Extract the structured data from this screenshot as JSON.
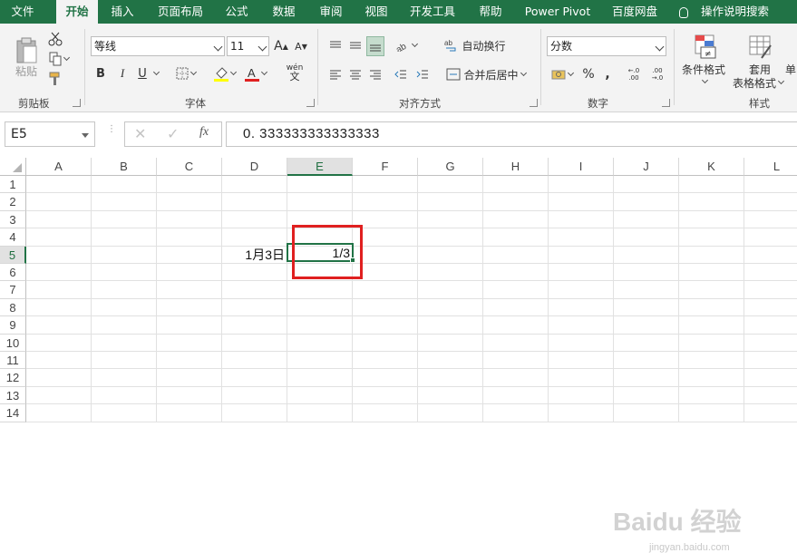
{
  "tabs": [
    "文件",
    "开始",
    "插入",
    "页面布局",
    "公式",
    "数据",
    "审阅",
    "视图",
    "开发工具",
    "帮助",
    "Power Pivot",
    "百度网盘"
  ],
  "active_tab": "开始",
  "tell_me": "操作说明搜索",
  "ribbon": {
    "clipboard": {
      "paste": "粘贴",
      "label": "剪贴板"
    },
    "font": {
      "name": "等线",
      "size": "11",
      "bold": "B",
      "italic": "I",
      "underline": "U",
      "phonetic": "wén",
      "label": "字体"
    },
    "alignment": {
      "wrap": "自动换行",
      "merge": "合并后居中",
      "label": "对齐方式"
    },
    "number": {
      "format": "分数",
      "percent": "%",
      "comma": ",",
      "inc_decimal": "←.0 .00",
      "dec_decimal": ".00 →.0",
      "label": "数字"
    },
    "styles": {
      "cond_format": "条件格式",
      "table_format_1": "套用",
      "table_format_2": "表格格式",
      "cell_styles": "单",
      "label": "样式"
    }
  },
  "formula_bar": {
    "name_box": "E5",
    "fx": "fx",
    "value": "0. 333333333333333"
  },
  "columns": [
    "A",
    "B",
    "C",
    "D",
    "E",
    "F",
    "G",
    "H",
    "I",
    "J",
    "K",
    "L"
  ],
  "rows": [
    "1",
    "2",
    "3",
    "4",
    "5",
    "6",
    "7",
    "8",
    "9",
    "10",
    "11",
    "12",
    "13",
    "14"
  ],
  "cells": {
    "D5": "1月3日",
    "E5": "1/3"
  },
  "watermark": {
    "main": "Baidu 经验",
    "sub": "jingyan.baidu.com"
  },
  "colors": {
    "accent": "#217346",
    "highlight": "#e02020"
  }
}
